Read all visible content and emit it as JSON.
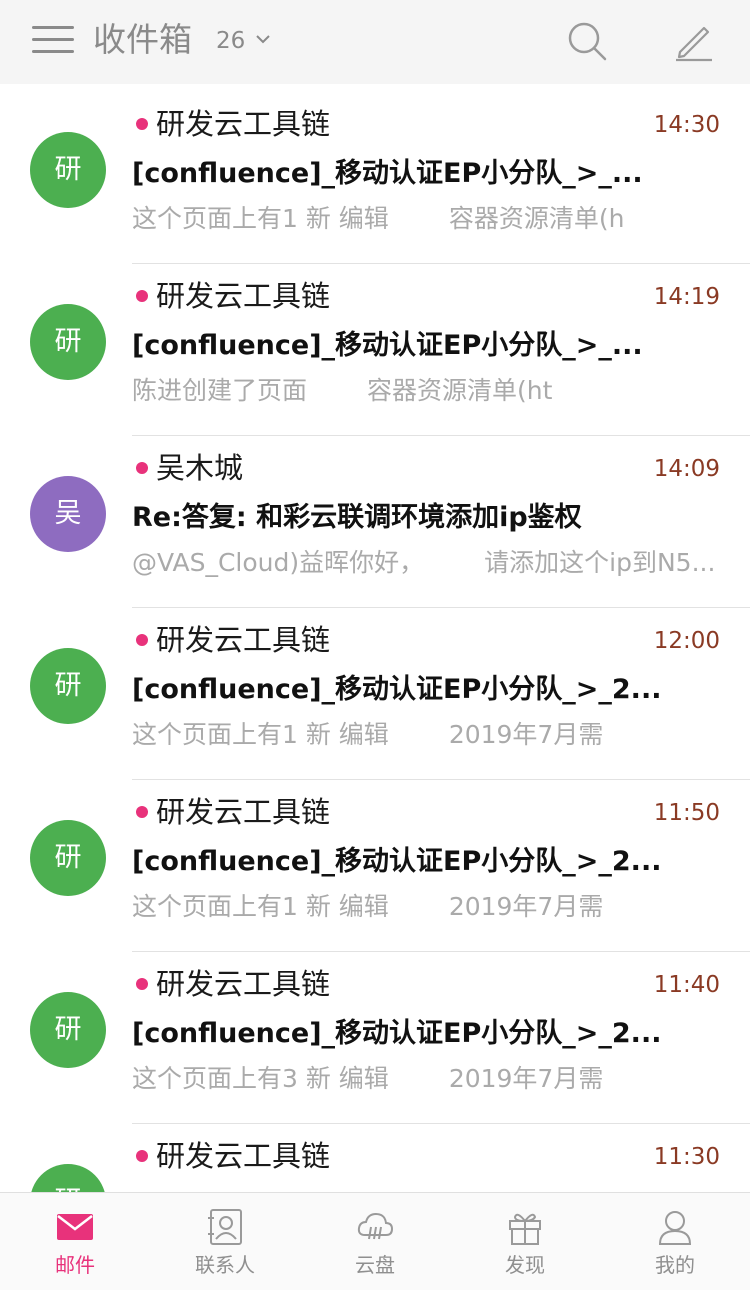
{
  "header": {
    "folder_title": "收件箱",
    "unread_count": "26",
    "icons": [
      "menu-icon",
      "chevron-down-icon",
      "search-icon",
      "compose-icon"
    ]
  },
  "colors": {
    "accent": "#e8327b",
    "avatar_green": "#4caf50",
    "avatar_purple": "#8e6cc0",
    "time_text": "#8a3a24"
  },
  "emails": [
    {
      "avatar": "研",
      "avatar_color": "#4caf50",
      "sender": "研发云工具链",
      "time": "14:30",
      "unread": true,
      "subject": "[confluence]_移动认证EP小分队_>_...",
      "preview_left": "这个页面上有1 新 编辑",
      "preview_right": "容器资源清单(h"
    },
    {
      "avatar": "研",
      "avatar_color": "#4caf50",
      "sender": "研发云工具链",
      "time": "14:19",
      "unread": true,
      "subject": "[confluence]_移动认证EP小分队_>_...",
      "preview_left": "陈进创建了页面",
      "preview_right": "容器资源清单(ht"
    },
    {
      "avatar": "吴",
      "avatar_color": "#8e6cc0",
      "sender": "吴木城",
      "time": "14:09",
      "unread": true,
      "subject": "Re:答复: 和彩云联调环境添加ip鉴权",
      "preview_left": "@VAS_Cloud)益晖你好，",
      "preview_right": "请添加这个ip到N5..."
    },
    {
      "avatar": "研",
      "avatar_color": "#4caf50",
      "sender": "研发云工具链",
      "time": "12:00",
      "unread": true,
      "subject": "[confluence]_移动认证EP小分队_>_2...",
      "preview_left": "这个页面上有1 新 编辑",
      "preview_right": "2019年7月需"
    },
    {
      "avatar": "研",
      "avatar_color": "#4caf50",
      "sender": "研发云工具链",
      "time": "11:50",
      "unread": true,
      "subject": "[confluence]_移动认证EP小分队_>_2...",
      "preview_left": "这个页面上有1 新 编辑",
      "preview_right": "2019年7月需"
    },
    {
      "avatar": "研",
      "avatar_color": "#4caf50",
      "sender": "研发云工具链",
      "time": "11:40",
      "unread": true,
      "subject": "[confluence]_移动认证EP小分队_>_2...",
      "preview_left": "这个页面上有3 新 编辑",
      "preview_right": "2019年7月需"
    },
    {
      "avatar": "研",
      "avatar_color": "#4caf50",
      "sender": "研发云工具链",
      "time": "11:30",
      "unread": true,
      "subject": "",
      "preview_left": "",
      "preview_right": ""
    }
  ],
  "tabs": [
    {
      "label": "邮件",
      "icon": "mail-icon",
      "active": true
    },
    {
      "label": "联系人",
      "icon": "contacts-icon",
      "active": false
    },
    {
      "label": "云盘",
      "icon": "cloud-drive-icon",
      "active": false
    },
    {
      "label": "发现",
      "icon": "gift-icon",
      "active": false
    },
    {
      "label": "我的",
      "icon": "profile-icon",
      "active": false
    }
  ]
}
